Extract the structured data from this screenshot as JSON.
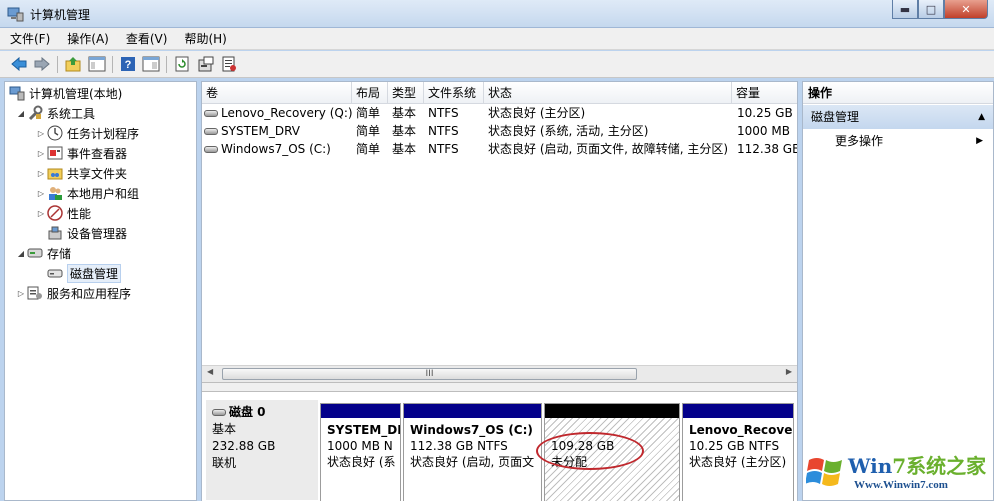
{
  "window": {
    "title": "计算机管理"
  },
  "menu": [
    "文件(F)",
    "操作(A)",
    "查看(V)",
    "帮助(H)"
  ],
  "toolbar": [
    "back-icon",
    "forward-icon",
    "up-folder-icon",
    "show-tree-icon",
    "help-icon",
    "properties-icon",
    "refresh-icon",
    "settings-icon",
    "export-icon"
  ],
  "tree": [
    {
      "label": "计算机管理(本地)",
      "icon": "computer-management-icon"
    },
    {
      "label": "系统工具",
      "icon": "tools-icon"
    },
    {
      "label": "任务计划程序",
      "icon": "clock-icon"
    },
    {
      "label": "事件查看器",
      "icon": "event-viewer-icon"
    },
    {
      "label": "共享文件夹",
      "icon": "shared-folder-icon"
    },
    {
      "label": "本地用户和组",
      "icon": "users-icon"
    },
    {
      "label": "性能",
      "icon": "performance-icon"
    },
    {
      "label": "设备管理器",
      "icon": "device-manager-icon"
    },
    {
      "label": "存储",
      "icon": "storage-icon"
    },
    {
      "label": "磁盘管理",
      "icon": "disk-icon"
    },
    {
      "label": "服务和应用程序",
      "icon": "services-icon"
    }
  ],
  "volume_table": {
    "headers": [
      "卷",
      "布局",
      "类型",
      "文件系统",
      "状态",
      "容量"
    ],
    "rows": [
      [
        "Lenovo_Recovery (Q:)",
        "简单",
        "基本",
        "NTFS",
        "状态良好 (主分区)",
        "10.25 GB"
      ],
      [
        "SYSTEM_DRV",
        "简单",
        "基本",
        "NTFS",
        "状态良好 (系统, 活动, 主分区)",
        "1000 MB"
      ],
      [
        "Windows7_OS (C:)",
        "简单",
        "基本",
        "NTFS",
        "状态良好 (启动, 页面文件, 故障转储, 主分区)",
        "112.38 GB"
      ]
    ],
    "scroll_thumb": "III"
  },
  "disk": {
    "name": "磁盘 0",
    "type": "基本",
    "size": "232.88 GB",
    "status": "联机",
    "partitions": [
      {
        "name": "SYSTEM_DI",
        "size": "1000 MB N",
        "status": "状态良好 (系"
      },
      {
        "name": "Windows7_OS  (C:)",
        "size": "112.38 GB NTFS",
        "status": "状态良好 (启动, 页面文"
      },
      {
        "name": "",
        "size": "109.28 GB",
        "status": "未分配"
      },
      {
        "name": "Lenovo_Recover",
        "size": "10.25 GB NTFS",
        "status": "状态良好 (主分区)"
      }
    ]
  },
  "actions": {
    "header": "操作",
    "section": "磁盘管理",
    "more": "更多操作"
  },
  "watermark": {
    "title_part1": "Win",
    "title_part2": "7系统之家",
    "url": "Www.Winwin7.com"
  },
  "colors": {
    "partition_bar": "#03008a",
    "unallocated_bar": "#000000",
    "highlight_oval": "#c0282d"
  }
}
